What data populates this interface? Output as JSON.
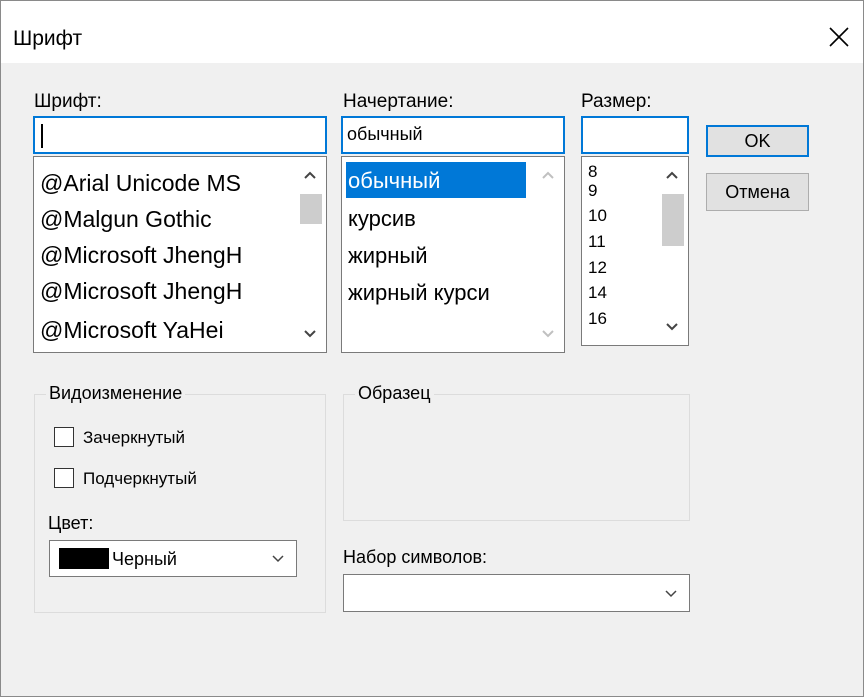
{
  "dialog": {
    "title": "Шрифт"
  },
  "font": {
    "label": "Шрифт:",
    "value": "",
    "items": [
      "@Arial Unicode MS",
      "@Malgun Gothic",
      "@Microsoft JhengH",
      "@Microsoft JhengH",
      "@Microsoft YaHei"
    ]
  },
  "style": {
    "label": "Начертание:",
    "value": "обычный",
    "items": [
      "обычный",
      "курсив",
      "жирный",
      "жирный курси"
    ],
    "selected_index": 0
  },
  "size": {
    "label": "Размер:",
    "value": "",
    "items": [
      "8",
      "9",
      "10",
      "11",
      "12",
      "14",
      "16"
    ]
  },
  "buttons": {
    "ok": "OK",
    "cancel": "Отмена"
  },
  "effects": {
    "title": "Видоизменение",
    "strikeout": {
      "label": "Зачеркнутый",
      "checked": false
    },
    "underline": {
      "label": "Подчеркнутый",
      "checked": false
    },
    "color_label": "Цвет:",
    "color_value": "Черный",
    "color_hex": "#000000"
  },
  "sample": {
    "title": "Образец"
  },
  "charset": {
    "label": "Набор символов:",
    "value": ""
  },
  "colors": {
    "accent": "#0078d7",
    "background": "#f0f0f0",
    "scroll_thumb": "#cdcdcd"
  },
  "icons": [
    "close-icon",
    "chevron-up-icon",
    "chevron-down-icon"
  ]
}
